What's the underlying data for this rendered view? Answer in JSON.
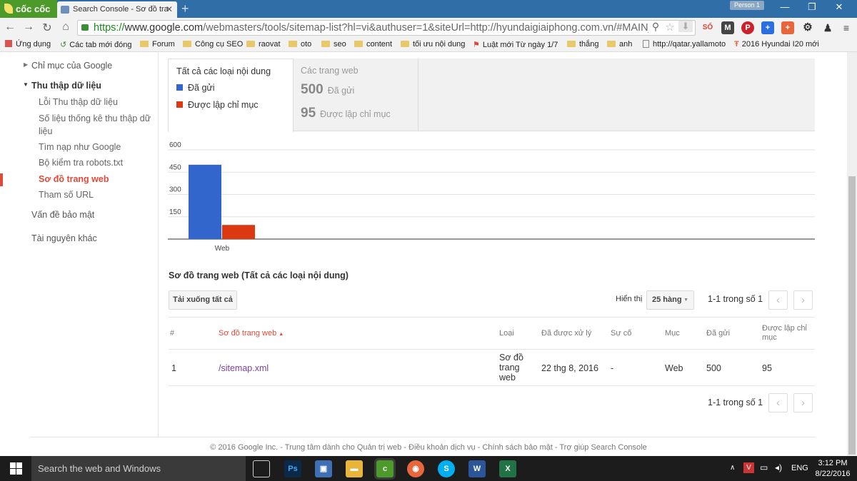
{
  "browser": {
    "logo_text": "cốc cốc",
    "tab_title": "Search Console - Sơ đồ tra",
    "person": "Person 1",
    "url_scheme": "https://",
    "url_host": "www.google.com",
    "url_rest": "/webmasters/tools/sitemap-list?hl=vi&authuser=1&siteUrl=http://hyundaigiaiphong.com.vn/#MAIN_",
    "bookmarks": [
      "Ứng dụng",
      "Các tab mới đóng",
      "Forum",
      "Công cụ SEO",
      "raovat",
      "oto",
      "seo",
      "content",
      "tối ưu nội dung",
      "Luật mới Từ ngày 1/7",
      "thắng",
      "anh",
      "http://qatar.yallamoto",
      "2016 Hyundai I20 mới"
    ]
  },
  "sidebar": {
    "index": "Chỉ mục của Google",
    "crawl": "Thu thập dữ liệu",
    "crawl_errors": "Lỗi Thu thập dữ liệu",
    "crawl_stats_1": "Số liệu thống kê thu thập dữ",
    "crawl_stats_2": "liệu",
    "fetch": "Tìm nạp như Google",
    "robots": "Bộ kiểm tra robots.txt",
    "sitemaps": "Sơ đồ trang web",
    "url_params": "Tham số URL",
    "security": "Vấn đề bảo mật",
    "other": "Tài nguyên khác"
  },
  "chart_header": {
    "tab1_title": "Tất cả các loại nội dung",
    "legend_submitted": "Đã gửi",
    "legend_indexed": "Được lập chỉ mục",
    "tab2_title": "Các trang web",
    "submitted_num": "500",
    "submitted_lbl": "Đã gửi",
    "indexed_num": "95",
    "indexed_lbl": "Được lập chỉ mục"
  },
  "colors": {
    "submitted": "#3366cc",
    "indexed": "#dc3912",
    "accent": "#dd4b39"
  },
  "chart_data": {
    "type": "bar",
    "categories": [
      "Web"
    ],
    "series": [
      {
        "name": "Đã gửi",
        "values": [
          500
        ]
      },
      {
        "name": "Được lập chỉ mục",
        "values": [
          95
        ]
      }
    ],
    "ytick_labels": [
      "150",
      "300",
      "450",
      "600"
    ],
    "ylim": [
      0,
      600
    ],
    "grid": true
  },
  "table": {
    "title": "Sơ đồ trang web (Tất cả các loại nội dung)",
    "download_all": "Tải xuống tất cả",
    "show_label": "Hiển thị",
    "rows_select": "25 hàng",
    "pagination": "1-1 trong số 1",
    "headers": {
      "num": "#",
      "sitemap": "Sơ đồ trang web",
      "type": "Loại",
      "processed": "Đã được xử lý",
      "issues": "Sự cố",
      "items": "Mục",
      "submitted": "Đã gửi",
      "indexed_1": "Được lập chỉ",
      "indexed_2": "mục"
    },
    "row": {
      "num": "1",
      "sitemap": "/sitemap.xml",
      "type_1": "Sơ đồ",
      "type_2": "trang",
      "type_3": "web",
      "processed": "22 thg 8, 2016",
      "issues": "-",
      "items": "Web",
      "submitted": "500",
      "indexed": "95"
    }
  },
  "footer": "© 2016 Google Inc. - Trung tâm dành cho Quản trị web - Điều khoản dịch vụ - Chính sách bảo mật - Trợ giúp Search Console",
  "taskbar": {
    "search_placeholder": "Search the web and Windows",
    "lang": "ENG",
    "time": "3:12 PM",
    "date": "8/22/2016"
  }
}
